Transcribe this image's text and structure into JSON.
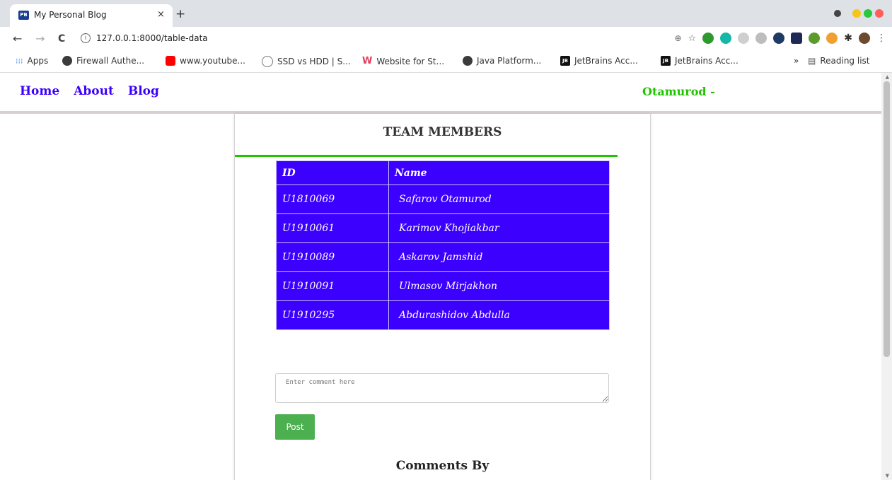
{
  "browser": {
    "tab_title": "My Personal Blog",
    "tab_favicon": "PB",
    "tab_close": "×",
    "new_tab": "+",
    "url": "127.0.0.1:8000/table-data",
    "back": "←",
    "forward": "→",
    "reload": "C",
    "info": "i",
    "bookmarks": [
      {
        "label": "Apps",
        "icon": "apps-grid-icon"
      },
      {
        "label": "Firewall Authe...",
        "icon": "globe-icon"
      },
      {
        "label": "www.youtube...",
        "icon": "youtube-icon"
      },
      {
        "label": "SSD vs HDD | S...",
        "icon": "site-icon"
      },
      {
        "label": "Website for St...",
        "icon": "w-logo-icon"
      },
      {
        "label": "Java Platform...",
        "icon": "globe-icon"
      },
      {
        "label": "JetBrains Acc...",
        "icon": "jetbrains-icon"
      },
      {
        "label": "JetBrains Acc...",
        "icon": "jetbrains-icon"
      }
    ],
    "more_bookmarks": "»",
    "reading_list": "Reading list",
    "colors": {
      "tabstrip": "#dee1e6",
      "youtube": "#ff0000",
      "mac_yellow": "#f5c518",
      "mac_green": "#27c93f",
      "mac_red": "#ff5f56"
    }
  },
  "site": {
    "nav": [
      {
        "label": "Home"
      },
      {
        "label": "About"
      },
      {
        "label": "Blog"
      }
    ],
    "user": "Otamurod -",
    "heading": "TEAM MEMBERS",
    "table": {
      "headers": [
        "ID",
        "Name"
      ],
      "rows": [
        [
          "U1810069",
          "Safarov Otamurod"
        ],
        [
          "U1910061",
          "Karimov Khojiakbar"
        ],
        [
          "U1910089",
          "Askarov Jamshid"
        ],
        [
          "U1910091",
          "Ulmasov Mirjakhon"
        ],
        [
          "U1910295",
          "Abdurashidov Abdulla"
        ]
      ]
    },
    "comment_placeholder": "Enter comment here",
    "post_label": "Post",
    "comments_heading": "Comments By",
    "colors": {
      "nav_link": "#3c00ff",
      "user": "#22c300",
      "table_bg": "#3c00ff",
      "rule": "#22c300",
      "post_button": "#4caf50"
    }
  }
}
